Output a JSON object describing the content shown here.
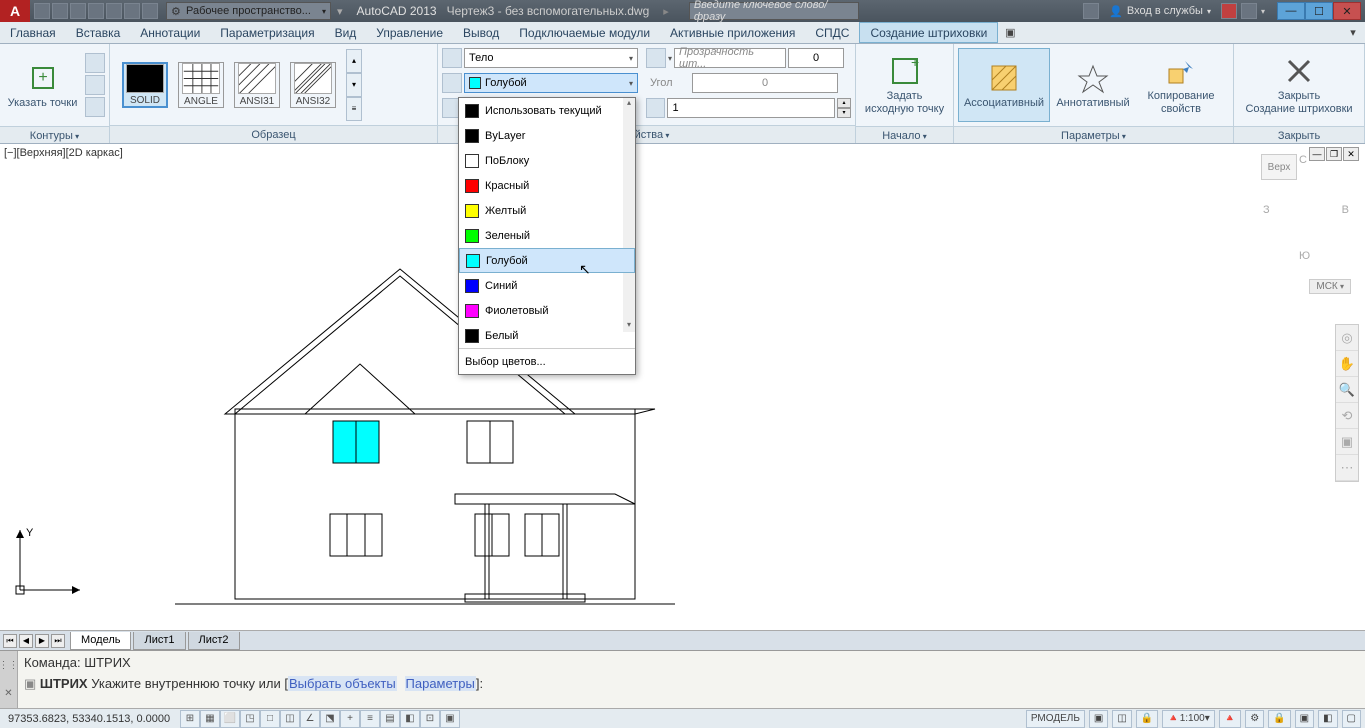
{
  "titlebar": {
    "workspace": "Рабочее пространство...",
    "app": "AutoCAD 2013",
    "doc": "Чертеж3 - без вспомогательных.dwg",
    "search_placeholder": "Введите ключевое слово/фразу",
    "login": "Вход в службы"
  },
  "menus": [
    "Главная",
    "Вставка",
    "Аннотации",
    "Параметризация",
    "Вид",
    "Управление",
    "Вывод",
    "Подключаемые модули",
    "Активные приложения",
    "СПДС",
    "Создание штриховки"
  ],
  "ribbon": {
    "contours": {
      "label": "Контуры",
      "button": "Указать точки"
    },
    "pattern": {
      "label": "Образец",
      "swatches": [
        {
          "name": "SOLID",
          "kind": "solid"
        },
        {
          "name": "ANGLE",
          "kind": "angle"
        },
        {
          "name": "ANSI31",
          "kind": "ansi31"
        },
        {
          "name": "ANSI32",
          "kind": "ansi32"
        }
      ]
    },
    "props": {
      "label": "…йства",
      "type_value": "Тело",
      "color_value": "Голубой",
      "angle_label": "Угол",
      "angle_value": "0",
      "transparency_placeholder": "Прозрачность шт...",
      "transparency_value": "0",
      "scale_value": "1"
    },
    "origin": {
      "label": "Начало",
      "button": "Задать\nисходную точку"
    },
    "options": {
      "label": "Параметры",
      "assoc": "Ассоциативный",
      "annot": "Аннотативный",
      "copy": "Копирование\nсвойств"
    },
    "close": {
      "label": "Закрыть",
      "button": "Закрыть\nСоздание штриховки"
    }
  },
  "color_dropdown": {
    "items": [
      {
        "label": "Использовать текущий",
        "color": "#000"
      },
      {
        "label": "ByLayer",
        "color": "#000"
      },
      {
        "label": "ПоБлоку",
        "color": "#fff",
        "border": true
      },
      {
        "label": "Красный",
        "color": "#ff0000"
      },
      {
        "label": "Желтый",
        "color": "#ffff00"
      },
      {
        "label": "Зеленый",
        "color": "#00ff00"
      },
      {
        "label": "Голубой",
        "color": "#00ffff",
        "highlighted": true
      },
      {
        "label": "Синий",
        "color": "#0000ff"
      },
      {
        "label": "Фиолетовый",
        "color": "#ff00ff"
      },
      {
        "label": "Белый",
        "color": "#000"
      }
    ],
    "more": "Выбор цветов..."
  },
  "viewport": {
    "label": "[−][Верхняя][2D каркас]",
    "viewcube": {
      "top": "Верх",
      "n": "С",
      "s": "Ю",
      "e": "В",
      "w": "З"
    },
    "wcs": "МСК"
  },
  "sheets": {
    "tabs": [
      "Модель",
      "Лист1",
      "Лист2"
    ]
  },
  "command": {
    "history": "Команда:  ШТРИХ",
    "prompt_prefix": "ШТРИХ ",
    "prompt_text": "Укажите внутреннюю точку или [",
    "opt1": "Выбрать объекты",
    "opt2": "Параметры",
    "prompt_suffix": "]:"
  },
  "statusbar": {
    "coords": "97353.6823, 53340.1513, 0.0000",
    "right_items": [
      "РМОДЕЛЬ",
      "",
      "",
      "",
      "1:100",
      "",
      "",
      "",
      ""
    ]
  }
}
